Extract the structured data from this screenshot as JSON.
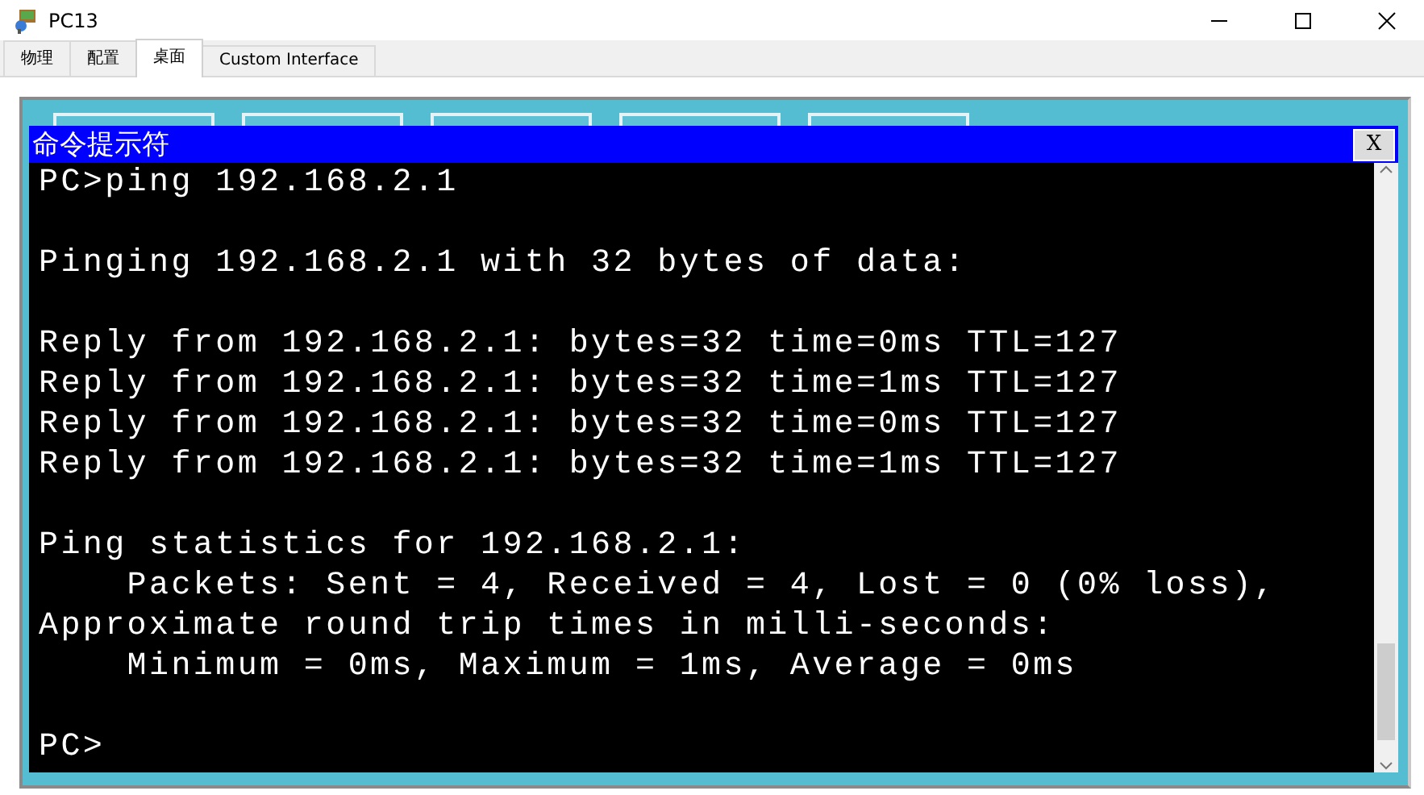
{
  "window": {
    "title": "PC13"
  },
  "tabs": [
    {
      "label": "物理",
      "selected": false
    },
    {
      "label": "配置",
      "selected": false
    },
    {
      "label": "桌面",
      "selected": true
    },
    {
      "label": "Custom Interface",
      "selected": false
    }
  ],
  "command_prompt": {
    "title": "命令提示符",
    "close_label": "X",
    "blocks": [
      [
        "PC>ping 192.168.2.1"
      ],
      [
        "Pinging 192.168.2.1 with 32 bytes of data:"
      ],
      [
        "Reply from 192.168.2.1: bytes=32 time=0ms TTL=127",
        "Reply from 192.168.2.1: bytes=32 time=1ms TTL=127",
        "Reply from 192.168.2.1: bytes=32 time=0ms TTL=127",
        "Reply from 192.168.2.1: bytes=32 time=1ms TTL=127"
      ],
      [
        "Ping statistics for 192.168.2.1:",
        "    Packets: Sent = 4, Received = 4, Lost = 0 (0% loss),",
        "Approximate round trip times in milli-seconds:",
        "    Minimum = 0ms, Maximum = 1ms, Average = 0ms"
      ],
      [
        "PC>"
      ]
    ]
  }
}
